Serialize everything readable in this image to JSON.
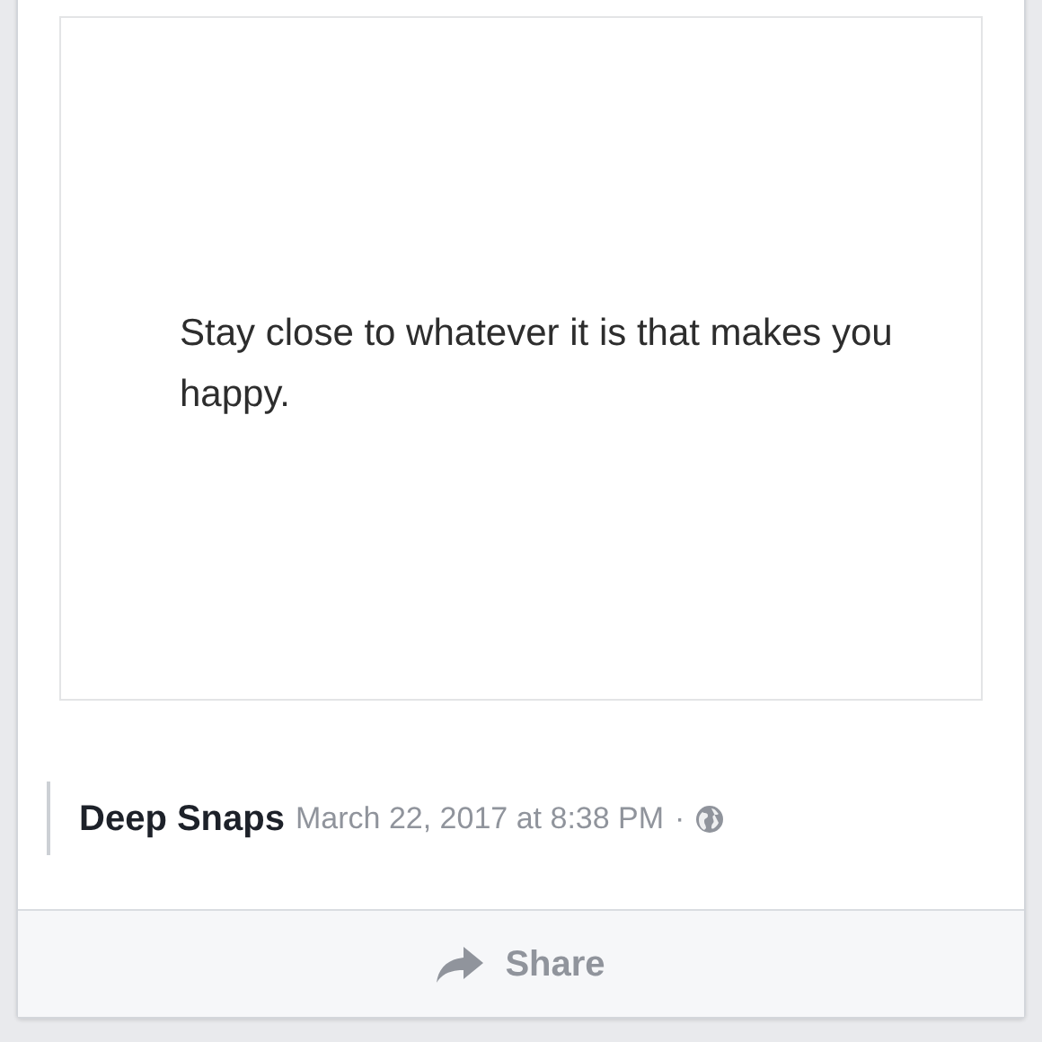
{
  "post": {
    "quote": "Stay close to whatever it is that makes you happy.",
    "author": "Deep Snaps",
    "timestamp": "March 22, 2017 at 8:38 PM",
    "separator": "·"
  },
  "actions": [
    {
      "label": "Share"
    }
  ]
}
